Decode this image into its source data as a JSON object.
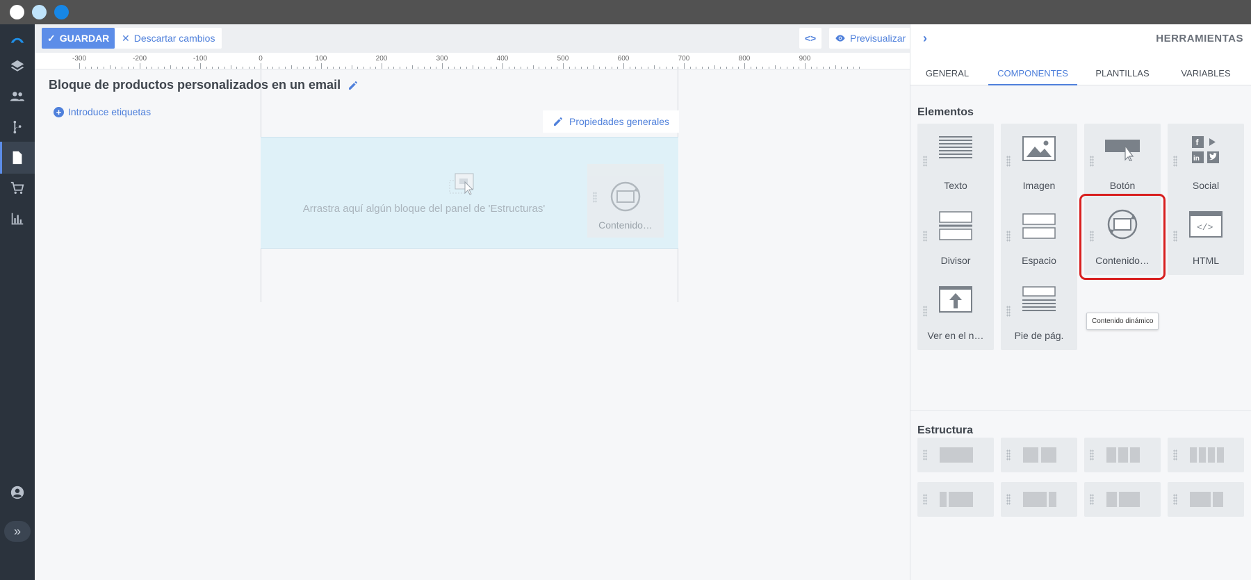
{
  "toolbar": {
    "save_label": "GUARDAR",
    "discard_label": "Descartar cambios",
    "preview_label": "Previsualizar"
  },
  "ruler": {
    "ticks": [
      "-300",
      "-200",
      "-100",
      "0",
      "100",
      "200",
      "300",
      "400",
      "500",
      "600",
      "700",
      "800",
      "900"
    ]
  },
  "editor": {
    "title": "Bloque de productos personalizados en un email",
    "tags_label": "Introduce etiquetas",
    "properties_label": "Propiedades generales",
    "drop_hint": "Arrastra aquí algún bloque del panel de 'Estructuras'",
    "dragged_item_label": "Contenido…"
  },
  "panel": {
    "title": "HERRAMIENTAS",
    "tabs": [
      "GENERAL",
      "COMPONENTES",
      "PLANTILLAS",
      "VARIABLES"
    ],
    "active_tab": "COMPONENTES",
    "elements_title": "Elementos",
    "elements": [
      {
        "label": "Texto",
        "icon": "text-icon"
      },
      {
        "label": "Imagen",
        "icon": "image-icon"
      },
      {
        "label": "Botón",
        "icon": "button-icon"
      },
      {
        "label": "Social",
        "icon": "social-icon"
      },
      {
        "label": "Divisor",
        "icon": "divider-icon"
      },
      {
        "label": "Espacio",
        "icon": "spacer-icon"
      },
      {
        "label": "Contenido…",
        "icon": "dynamic-content-icon"
      },
      {
        "label": "HTML",
        "icon": "html-icon"
      },
      {
        "label": "Ver en el n…",
        "icon": "view-in-browser-icon"
      },
      {
        "label": "Pie de pág.",
        "icon": "footer-icon"
      }
    ],
    "tooltip": "Contenido dinámico",
    "structure_title": "Estructura"
  },
  "colors": {
    "accent": "#4f80db",
    "selection": "#d81f1f",
    "sidebar": "#2b333d"
  }
}
